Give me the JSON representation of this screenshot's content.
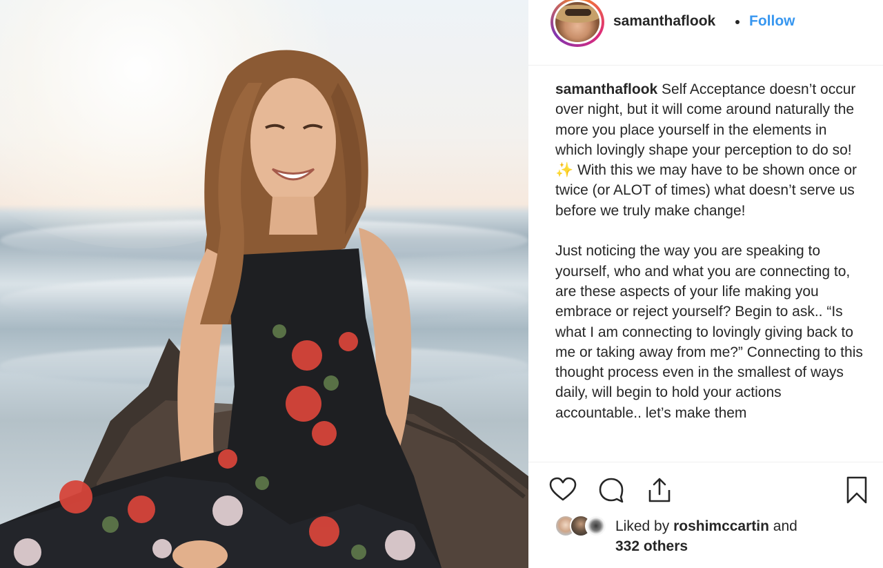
{
  "post": {
    "username": "samanthaflook",
    "follow_label": "Follow",
    "caption_username": "samanthaflook",
    "caption_text": "Self Acceptance doesn’t occur over night, but it will come around naturally the more you place yourself in the elements in which lovingly shape your perception to do so! ✨ With this we may have to be shown once or twice (or ALOT of times) what doesn’t serve us before we truly make change!\n\nJust noticing the way you are speaking to yourself, who and what you are connecting to, are these aspects of your life making you embrace or reject yourself? Begin to ask.. “Is what I am connecting to lovingly giving back to me or taking away from me?” Connecting to this thought process even in the smallest of ways daily, will begin to hold your actions accountable.. let’s make them",
    "likes": {
      "prefix": "Liked by",
      "liker": "roshimccartin",
      "joiner": "and",
      "others": "332 others"
    }
  },
  "icons": {
    "like": "heart-icon",
    "comment": "comment-bubble-icon",
    "share": "share-upload-icon",
    "save": "bookmark-icon"
  },
  "colors": {
    "follow": "#3897f0",
    "text": "#262626",
    "divider": "#efefef",
    "avatar_ring": [
      "#f58529",
      "#dd2a7b",
      "#8134af"
    ]
  }
}
